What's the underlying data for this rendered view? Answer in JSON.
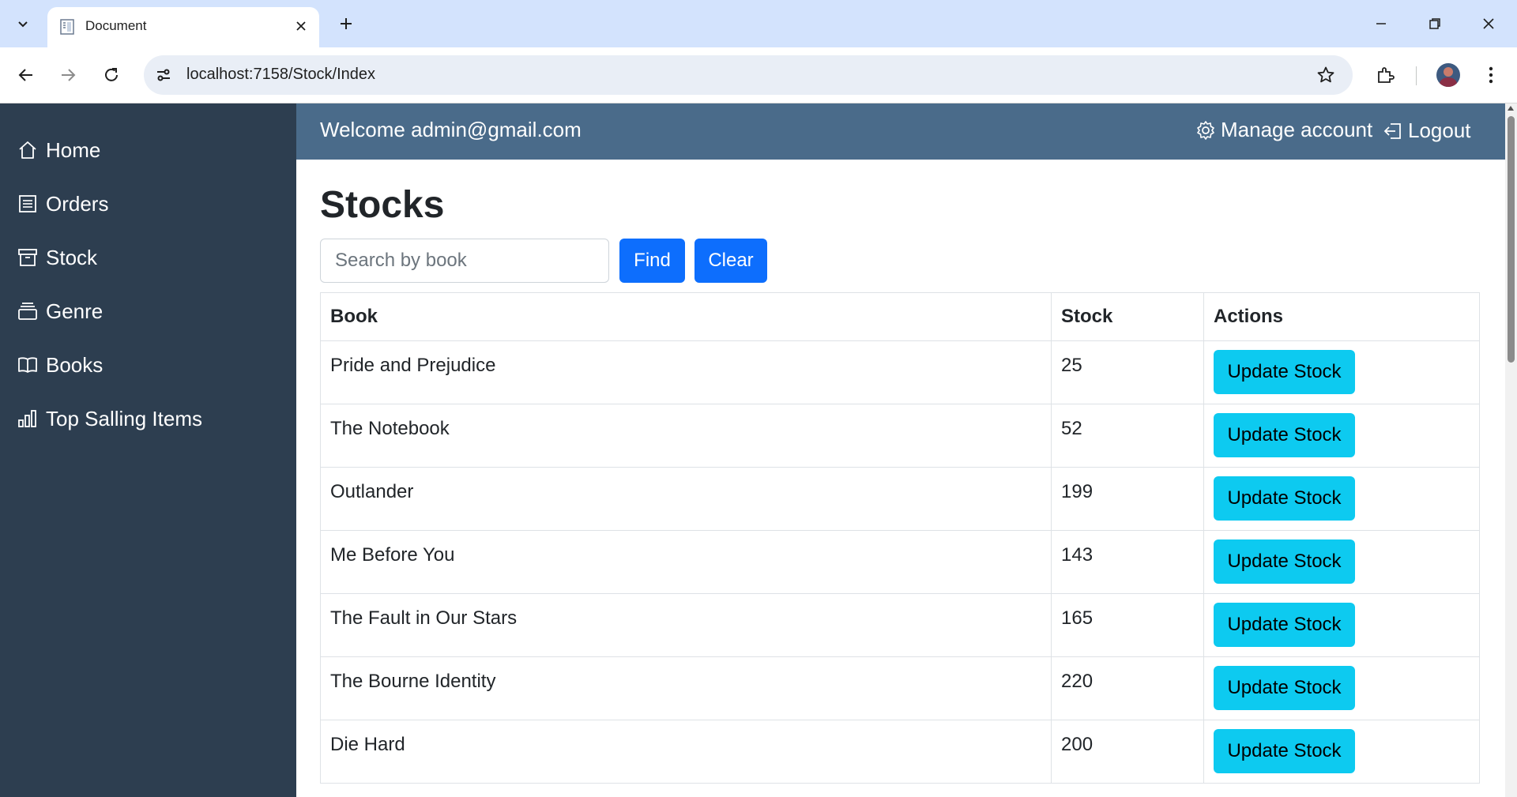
{
  "browser": {
    "tab_title": "Document",
    "url": "localhost:7158/Stock/Index"
  },
  "sidebar": {
    "items": [
      {
        "label": "Home",
        "icon": "house-icon"
      },
      {
        "label": "Orders",
        "icon": "receipt-icon"
      },
      {
        "label": "Stock",
        "icon": "archive-icon"
      },
      {
        "label": "Genre",
        "icon": "collection-icon"
      },
      {
        "label": "Books",
        "icon": "book-icon"
      },
      {
        "label": "Top Salling Items",
        "icon": "bar-chart-icon"
      }
    ]
  },
  "header": {
    "welcome": "Welcome admin@gmail.com",
    "manage_account": "Manage account",
    "logout": "Logout"
  },
  "main": {
    "title": "Stocks",
    "search_placeholder": "Search by book",
    "search_value": "",
    "find_label": "Find",
    "clear_label": "Clear",
    "table": {
      "headers": [
        "Book",
        "Stock",
        "Actions"
      ],
      "rows": [
        {
          "book": "Pride and Prejudice",
          "stock": "25",
          "action": "Update Stock"
        },
        {
          "book": "The Notebook",
          "stock": "52",
          "action": "Update Stock"
        },
        {
          "book": "Outlander",
          "stock": "199",
          "action": "Update Stock"
        },
        {
          "book": "Me Before You",
          "stock": "143",
          "action": "Update Stock"
        },
        {
          "book": "The Fault in Our Stars",
          "stock": "165",
          "action": "Update Stock"
        },
        {
          "book": "The Bourne Identity",
          "stock": "220",
          "action": "Update Stock"
        },
        {
          "book": "Die Hard",
          "stock": "200",
          "action": "Update Stock"
        }
      ]
    }
  },
  "colors": {
    "sidebar_bg": "#2d3e50",
    "header_bg": "#4a6b8a",
    "primary": "#0d6efd",
    "info": "#0dcaf0"
  }
}
